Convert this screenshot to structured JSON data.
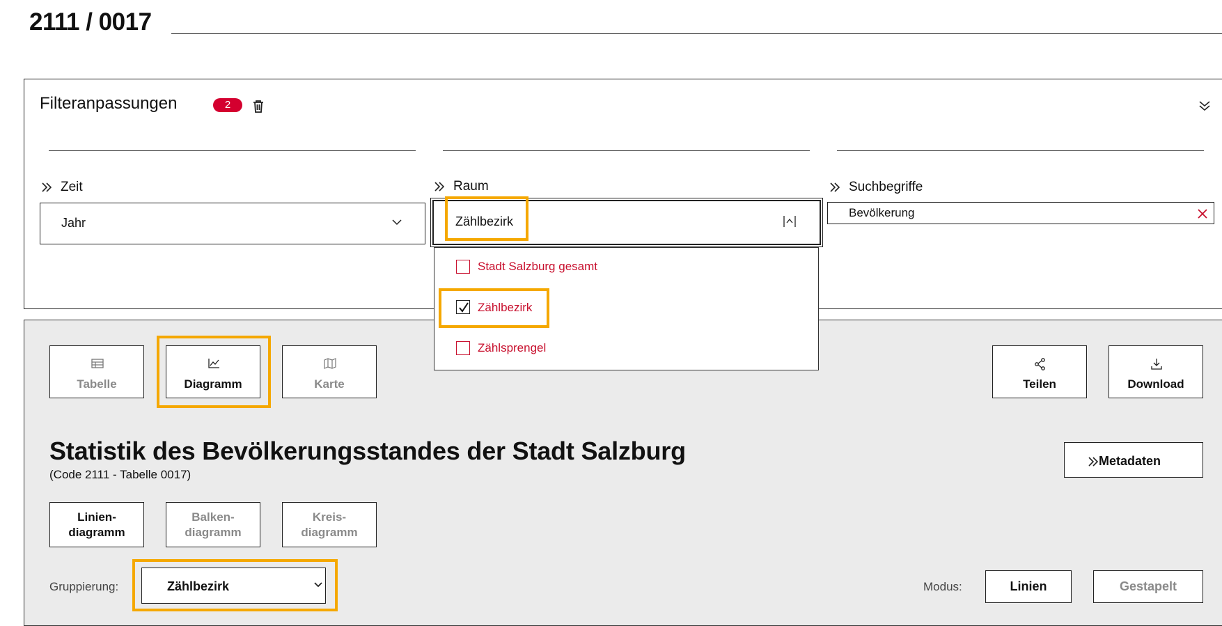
{
  "header": {
    "code": "2111 / 0017"
  },
  "filter": {
    "title": "Filteranpassungen",
    "badge_count": "2",
    "zeit": {
      "label": "Zeit",
      "value": "Jahr"
    },
    "raum": {
      "label": "Raum",
      "value": "Zählbezirk",
      "options": [
        {
          "label": "Stadt Salzburg gesamt",
          "checked": false
        },
        {
          "label": "Zählbezirk",
          "checked": true
        },
        {
          "label": "Zählsprengel",
          "checked": false
        }
      ]
    },
    "such": {
      "label": "Suchbegriffe",
      "value": "Bevölkerung"
    }
  },
  "views": {
    "tabelle": "Tabelle",
    "diagramm": "Diagramm",
    "karte": "Karte",
    "teilen": "Teilen",
    "download": "Download"
  },
  "main": {
    "title": "Statistik des Bevölkerungsstandes der Stadt Salzburg",
    "subtitle": "(Code 2111 - Tabelle 0017)",
    "metadaten": "Metadaten"
  },
  "chart_types": {
    "linien_1": "Linien-",
    "linien_2": "diagramm",
    "balken_1": "Balken-",
    "balken_2": "diagramm",
    "kreis_1": "Kreis-",
    "kreis_2": "diagramm"
  },
  "grouping": {
    "label": "Gruppierung:",
    "value": "Zählbezirk"
  },
  "mode": {
    "label": "Modus:",
    "linien": "Linien",
    "gestapelt": "Gestapelt"
  },
  "colors": {
    "accent_red": "#d4002f",
    "highlight": "#f5a800",
    "panel_bg": "#ebebeb"
  }
}
